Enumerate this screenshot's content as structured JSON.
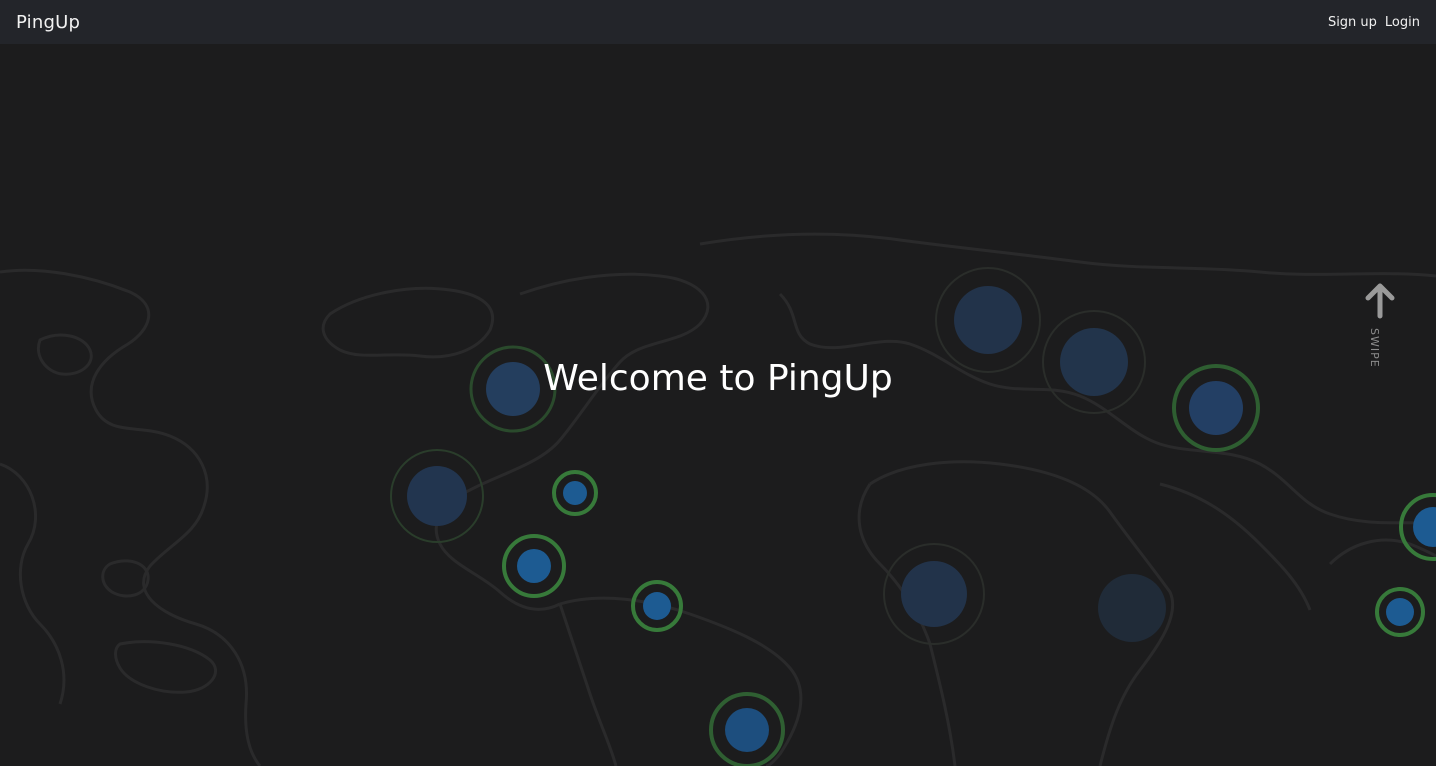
{
  "navbar": {
    "brand": "PingUp",
    "signup_label": "Sign up",
    "login_label": "Login"
  },
  "hero": {
    "heading": "Welcome to PingUp",
    "swipe_label": "SWIPE",
    "swipe_icon": "arrow-up-icon"
  },
  "colors": {
    "navbar_bg": "#23252a",
    "page_bg": "#1c1c1d",
    "land_outline": "#2a2a2b",
    "ping_ring_active": "#3a7a3c",
    "ping_dot_active": "#1a5a8f",
    "ping_dot_faded": "#24344a"
  }
}
